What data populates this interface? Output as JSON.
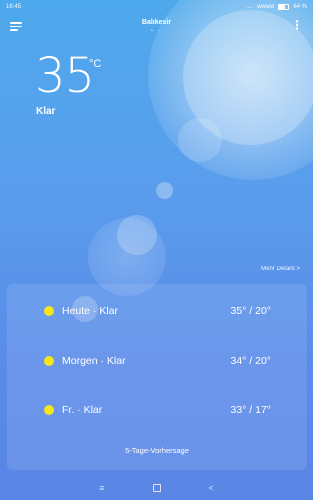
{
  "status_bar": {
    "time": "16:45",
    "signal": "....",
    "wifi": "wwww",
    "battery": "64 %"
  },
  "header": {
    "city": "Balıkesir",
    "page_dots": "• ◦"
  },
  "current": {
    "temperature": "35",
    "unit": "°C",
    "condition": "Klar"
  },
  "more_details": "Mehr Details  >",
  "forecast": [
    {
      "label": "Heute · Klar",
      "range": "35°  /  20°"
    },
    {
      "label": "Morgen · Klar",
      "range": "34°  /  20°"
    },
    {
      "label": "Fr. · Klar",
      "range": "33°  /  17°"
    }
  ],
  "forecast_footer": "5-Tage-Vorhersage",
  "nav": {
    "menu": "≡",
    "home": "",
    "back": "<"
  },
  "colors": {
    "sun_dot": "#f7e51b",
    "bg_top": "#4ea9ec",
    "bg_bottom": "#5a86e6"
  }
}
